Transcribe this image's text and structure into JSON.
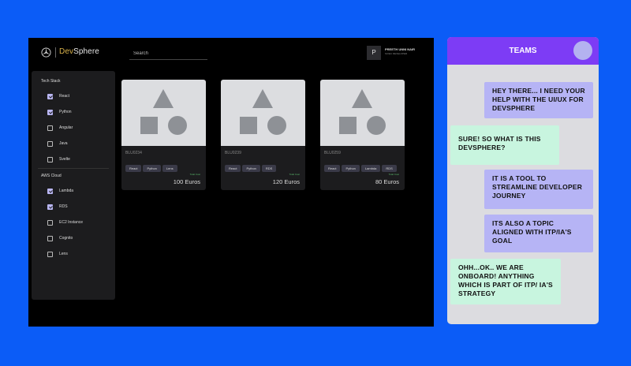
{
  "app": {
    "brand_dev": "Dev",
    "brand_sphere": "Sphere",
    "search_placeholder": "Search",
    "user": {
      "initial": "P",
      "name": "PREETH UNNI NAIR",
      "role": "SIVEC DEVELOPER"
    }
  },
  "sidebar": {
    "tech_title": "Tech Stack",
    "tech": [
      {
        "label": "React",
        "checked": true
      },
      {
        "label": "Python",
        "checked": true
      },
      {
        "label": "Angular",
        "checked": false
      },
      {
        "label": "Java",
        "checked": false
      },
      {
        "label": "Svelte",
        "checked": false
      }
    ],
    "aws_title": "AWS Cloud",
    "aws": [
      {
        "label": "Lambda",
        "checked": true
      },
      {
        "label": "RDS",
        "checked": true
      },
      {
        "label": "EC2 Instance",
        "checked": false
      },
      {
        "label": "Cognito",
        "checked": false
      },
      {
        "label": "Lens",
        "checked": false
      }
    ]
  },
  "cards": [
    {
      "id": "BLU0234",
      "tags": [
        "React",
        "Python",
        "Lens"
      ],
      "cost_label": "Total Cost",
      "cost": "100 Euros"
    },
    {
      "id": "BLU0239",
      "tags": [
        "React",
        "Python",
        "RDS"
      ],
      "cost_label": "Total Cost",
      "cost": "120 Euros"
    },
    {
      "id": "BLU0259",
      "tags": [
        "React",
        "Python",
        "Lambda",
        "RDS"
      ],
      "cost_label": "Total Cost",
      "cost": "80 Euros"
    }
  ],
  "teams": {
    "title": "TEAMS",
    "messages": [
      {
        "side": "right",
        "text": "HEY THERE... I NEED YOUR HELP WITH THE UI/UX FOR DEVSPHERE"
      },
      {
        "side": "left",
        "text": "SURE! SO WHAT IS THIS DEVSPHERE?"
      },
      {
        "side": "right",
        "text": "IT IS A TOOL TO STREAMLINE DEVELOPER JOURNEY"
      },
      {
        "side": "right",
        "text": "ITS ALSO A TOPIC ALIGNED WITH ITP/IA'S GOAL"
      },
      {
        "side": "left",
        "text": "OHH...OK.. WE ARE ONBOARD! ANYTHING WHICH IS PART OF ITP/ IA'S STRATEGY"
      }
    ]
  },
  "colors": {
    "background": "#0b5cf7",
    "teams_header": "#7d3cf5",
    "bubble_right": "#b6b4f5",
    "bubble_left": "#c8f5df",
    "brand_dev": "#d9b24a"
  }
}
